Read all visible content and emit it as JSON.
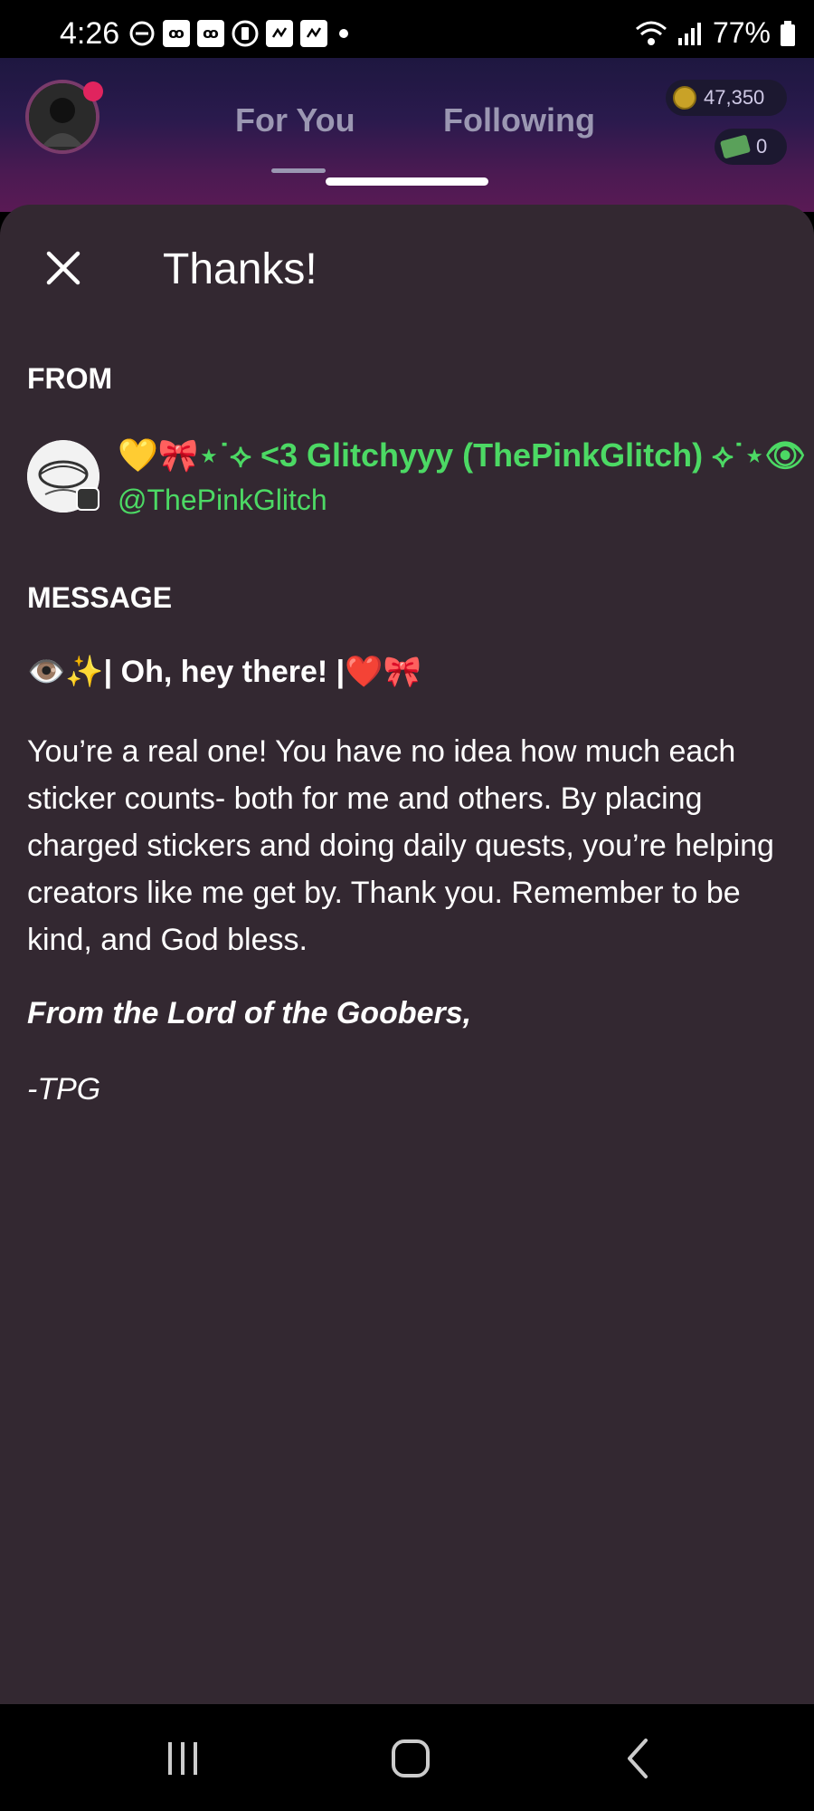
{
  "status_bar": {
    "time": "4:26",
    "battery": "77%"
  },
  "header": {
    "tabs": [
      {
        "label": "For You"
      },
      {
        "label": "Following"
      }
    ],
    "coins": "47,350",
    "cash": "0"
  },
  "sheet": {
    "title": "Thanks!",
    "from_label": "FROM",
    "sender": {
      "name": "💛🎀⋆˙⟡ <3 Glitchyyy (ThePinkGlitch) ⟡˙⋆👁",
      "handle": "@ThePinkGlitch"
    },
    "message_label": "MESSAGE",
    "greeting": "👁️✨| Oh, hey there! |❤️🎀",
    "body": "You’re a real one! You have no idea how much each sticker counts- both for me and others. By placing charged stickers and doing daily quests, you’re helping creators like me get by. Thank you. Remember to be kind, and God bless.",
    "signoff": "From the Lord of the Goobers,",
    "signature": "-TPG"
  },
  "colors": {
    "sheet_bg": "#332831",
    "accent_green": "#4cd964",
    "tab_inactive": "#9b97b2"
  }
}
